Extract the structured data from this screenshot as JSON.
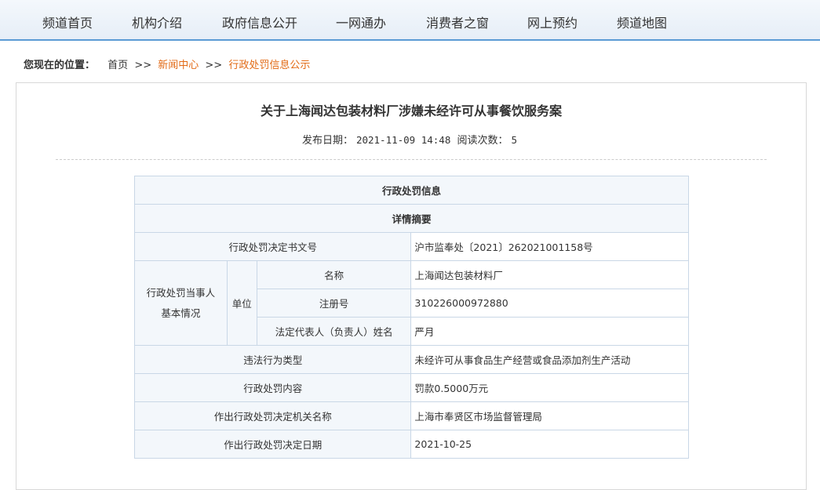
{
  "nav": {
    "items": [
      "频道首页",
      "机构介绍",
      "政府信息公开",
      "一网通办",
      "消费者之窗",
      "网上预约",
      "频道地图"
    ]
  },
  "breadcrumb": {
    "label": "您现在的位置：",
    "home": "首页",
    "sep1": ">>",
    "news": "新闻中心",
    "sep2": ">>",
    "current": "行政处罚信息公示"
  },
  "article": {
    "title": "关于上海闻达包装材料厂涉嫌未经许可从事餐饮服务案",
    "publish_label": "发布日期：",
    "publish_date": "2021-11-09 14:48",
    "read_label": "阅读次数：",
    "read_count": "5"
  },
  "table": {
    "header": "行政处罚信息",
    "subheader": "详情摘要",
    "doc_no_label": "行政处罚决定书文号",
    "doc_no": "沪市监奉处〔2021〕262021001158号",
    "party_label_1": "行政处罚当事人",
    "party_label_2": "基本情况",
    "unit_label": "单位",
    "name_label": "名称",
    "name": "上海闻达包装材料厂",
    "reg_label": "注册号",
    "reg_no": "310226000972880",
    "rep_label": "法定代表人（负责人）姓名",
    "rep_name": "严月",
    "violation_label": "违法行为类型",
    "violation": "未经许可从事食品生产经营或食品添加剂生产活动",
    "penalty_label": "行政处罚内容",
    "penalty": "罚款0.5000万元",
    "authority_label": "作出行政处罚决定机关名称",
    "authority": "上海市奉贤区市场监督管理局",
    "date_label": "作出行政处罚决定日期",
    "date": "2021-10-25"
  },
  "colors": {
    "nav_border": "#5b9bd5",
    "breadcrumb_accent": "#e26a15",
    "table_border": "#c9d7e6",
    "table_label_bg": "#f3f7fb"
  }
}
